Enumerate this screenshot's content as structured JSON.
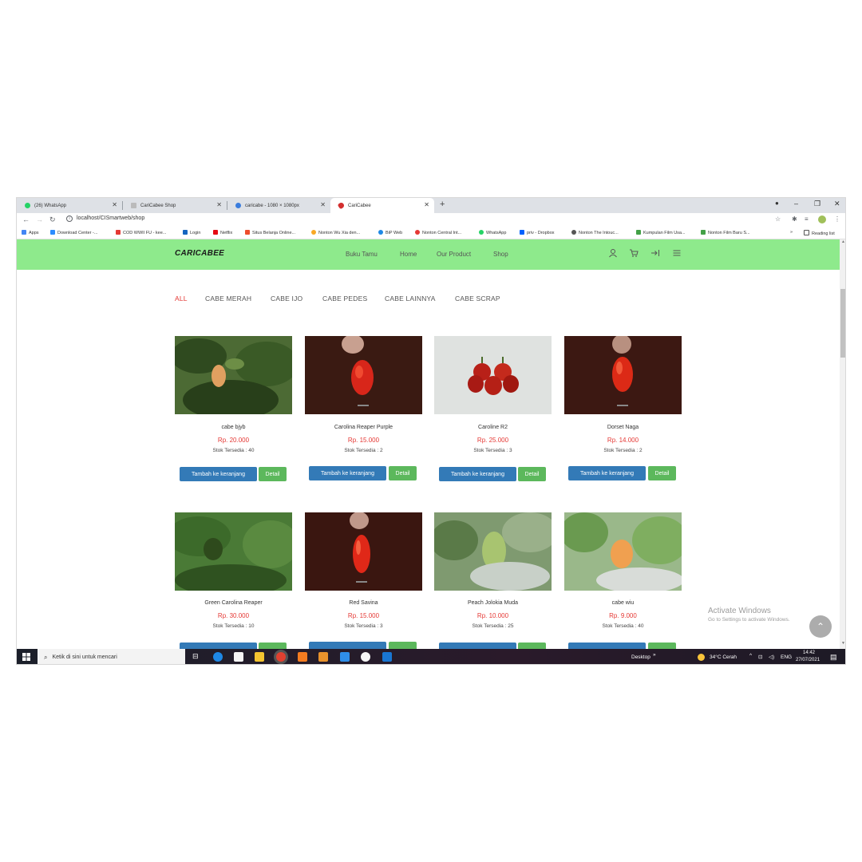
{
  "browser": {
    "tabs": [
      {
        "title": "(26) WhatsApp",
        "favicon_color": "#25d366"
      },
      {
        "title": "CariCabee Shop",
        "favicon_color": "#888888"
      },
      {
        "title": "caricabe - 1080 × 1080px",
        "favicon_color": "#3b7ddd"
      },
      {
        "title": "CariCabee",
        "favicon_color": "#d32f2f"
      }
    ],
    "new_tab": "+",
    "window_controls": {
      "minimize": "–",
      "maximize": "❐",
      "close": "✕"
    },
    "url": "localhost/CISmartweb/shop",
    "bookmarks": [
      {
        "label": "Apps",
        "color": "#4285f4"
      },
      {
        "label": "Download Center -...",
        "color": "#2d8cff"
      },
      {
        "label": "COD WWII FU - kee...",
        "color": "#e53935"
      },
      {
        "label": "Login",
        "color": "#1565c0"
      },
      {
        "label": "Netflix",
        "color": "#e50914"
      },
      {
        "label": "Situs Belanja Online...",
        "color": "#ee4d2d"
      },
      {
        "label": "Nonton Wu Xia den...",
        "color": "#f9a825"
      },
      {
        "label": "BiP Web",
        "color": "#1e88e5"
      },
      {
        "label": "Nonton Central Int...",
        "color": "#e53935"
      },
      {
        "label": "WhatsApp",
        "color": "#25d366"
      },
      {
        "label": "priv - Dropbox",
        "color": "#0061fe"
      },
      {
        "label": "Nonton The Intouc...",
        "color": "#555555"
      },
      {
        "label": "Kumpulan Film Usa...",
        "color": "#43a047"
      },
      {
        "label": "Nonton Film Baru S...",
        "color": "#43a047"
      }
    ],
    "more_bookmarks": "»",
    "reading_list": "Reading list"
  },
  "site": {
    "logo": "CARICABEE",
    "nav": [
      "Buku Tamu",
      "Home",
      "Our Product",
      "Shop"
    ],
    "nav_bg": "#8eea8c",
    "filters": [
      "ALL",
      "CABE MERAH",
      "CABE IJO",
      "CABE PEDES",
      "CABE LAINNYA",
      "CABE SCRAP"
    ],
    "active_filter_color": "#e53935",
    "cart_button_label": "Tambah ke keranjang",
    "detail_button_label": "Detail",
    "products": [
      {
        "name": "cabe bjyb",
        "price": "Rp. 20.000",
        "stock": "Stok Tersedia : 40"
      },
      {
        "name": "Carolina Reaper Purple",
        "price": "Rp. 15.000",
        "stock": "Stok Tersedia : 2"
      },
      {
        "name": "Caroline R2",
        "price": "Rp. 25.000",
        "stock": "Stok Tersedia : 3"
      },
      {
        "name": "Dorset Naga",
        "price": "Rp. 14.000",
        "stock": "Stok Tersedia : 2"
      },
      {
        "name": "Green Carolina Reaper",
        "price": "Rp. 30.000",
        "stock": "Stok Tersedia : 10"
      },
      {
        "name": "Red Savina",
        "price": "Rp. 15.000",
        "stock": "Stok Tersedia : 3"
      },
      {
        "name": "Peach Jolokia Muda",
        "price": "Rp. 10.000",
        "stock": "Stok Tersedia : 25"
      },
      {
        "name": "cabe wiu",
        "price": "Rp. 9.000",
        "stock": "Stok Tersedia : 40"
      }
    ]
  },
  "activate_windows": {
    "title": "Activate Windows",
    "subtitle": "Go to Settings to activate Windows."
  },
  "taskbar": {
    "search_placeholder": "Ketik di sini untuk mencari",
    "desktop_label": "Desktop",
    "weather": "34°C  Cerah",
    "language": "ENG",
    "time": "14:42",
    "date": "27/07/2021"
  }
}
